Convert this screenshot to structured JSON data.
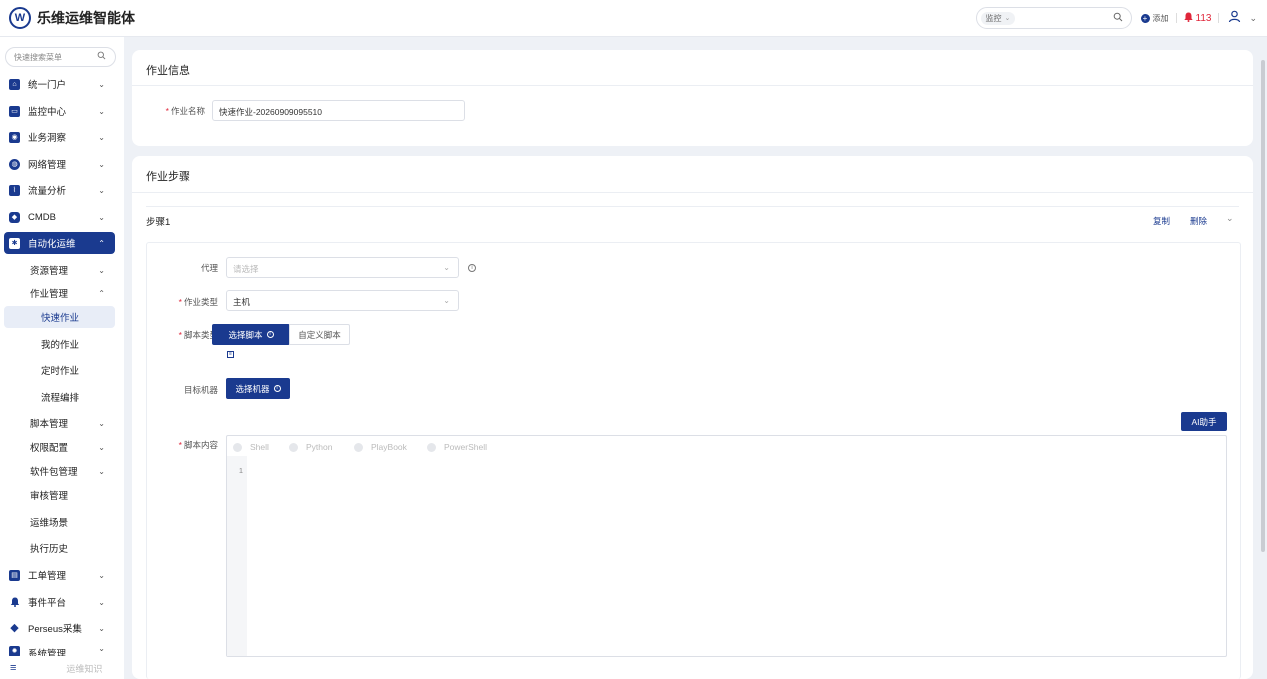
{
  "app": {
    "logo_letter": "W",
    "title": "乐维运维智能体"
  },
  "topbar": {
    "search_scope": "监控",
    "add_label": "添加",
    "alarm_count": "113"
  },
  "sidebar": {
    "search_placeholder": "快速搜索菜单",
    "items": [
      {
        "label": "统一门户"
      },
      {
        "label": "监控中心"
      },
      {
        "label": "业务洞察"
      },
      {
        "label": "网络管理"
      },
      {
        "label": "流量分析"
      },
      {
        "label": "CMDB"
      },
      {
        "label": "自动化运维"
      }
    ],
    "automation_sub": [
      {
        "label": "资源管理"
      },
      {
        "label": "作业管理"
      }
    ],
    "job_leaves": [
      {
        "label": "快速作业"
      },
      {
        "label": "我的作业"
      },
      {
        "label": "定时作业"
      },
      {
        "label": "流程编排"
      }
    ],
    "more_sub": [
      {
        "label": "脚本管理"
      },
      {
        "label": "权限配置"
      },
      {
        "label": "软件包管理"
      },
      {
        "label": "审核管理"
      },
      {
        "label": "运维场景"
      },
      {
        "label": "执行历史"
      }
    ],
    "bottom_items": [
      {
        "label": "工单管理"
      },
      {
        "label": "事件平台"
      },
      {
        "label": "Perseus采集"
      },
      {
        "label": "系统管理"
      }
    ],
    "footer_text": "运维知识"
  },
  "job_info": {
    "title": "作业信息",
    "name_label": "作业名称",
    "name_value": "快速作业-20260909095510"
  },
  "job_steps": {
    "title": "作业步骤",
    "step_label": "步骤1",
    "copy_label": "复制",
    "delete_label": "删除",
    "proxy_label": "代理",
    "proxy_placeholder": "请选择",
    "job_type_label": "作业类型",
    "job_type_value": "主机",
    "script_type_label": "脚本类型",
    "select_script_label": "选择脚本",
    "custom_script_label": "自定义脚本",
    "target_label": "目标机器",
    "select_machine_label": "选择机器",
    "ai_label": "AI助手",
    "script_content_label": "脚本内容",
    "languages": [
      "Shell",
      "Python",
      "PlayBook",
      "PowerShell"
    ],
    "line_number": "1"
  }
}
